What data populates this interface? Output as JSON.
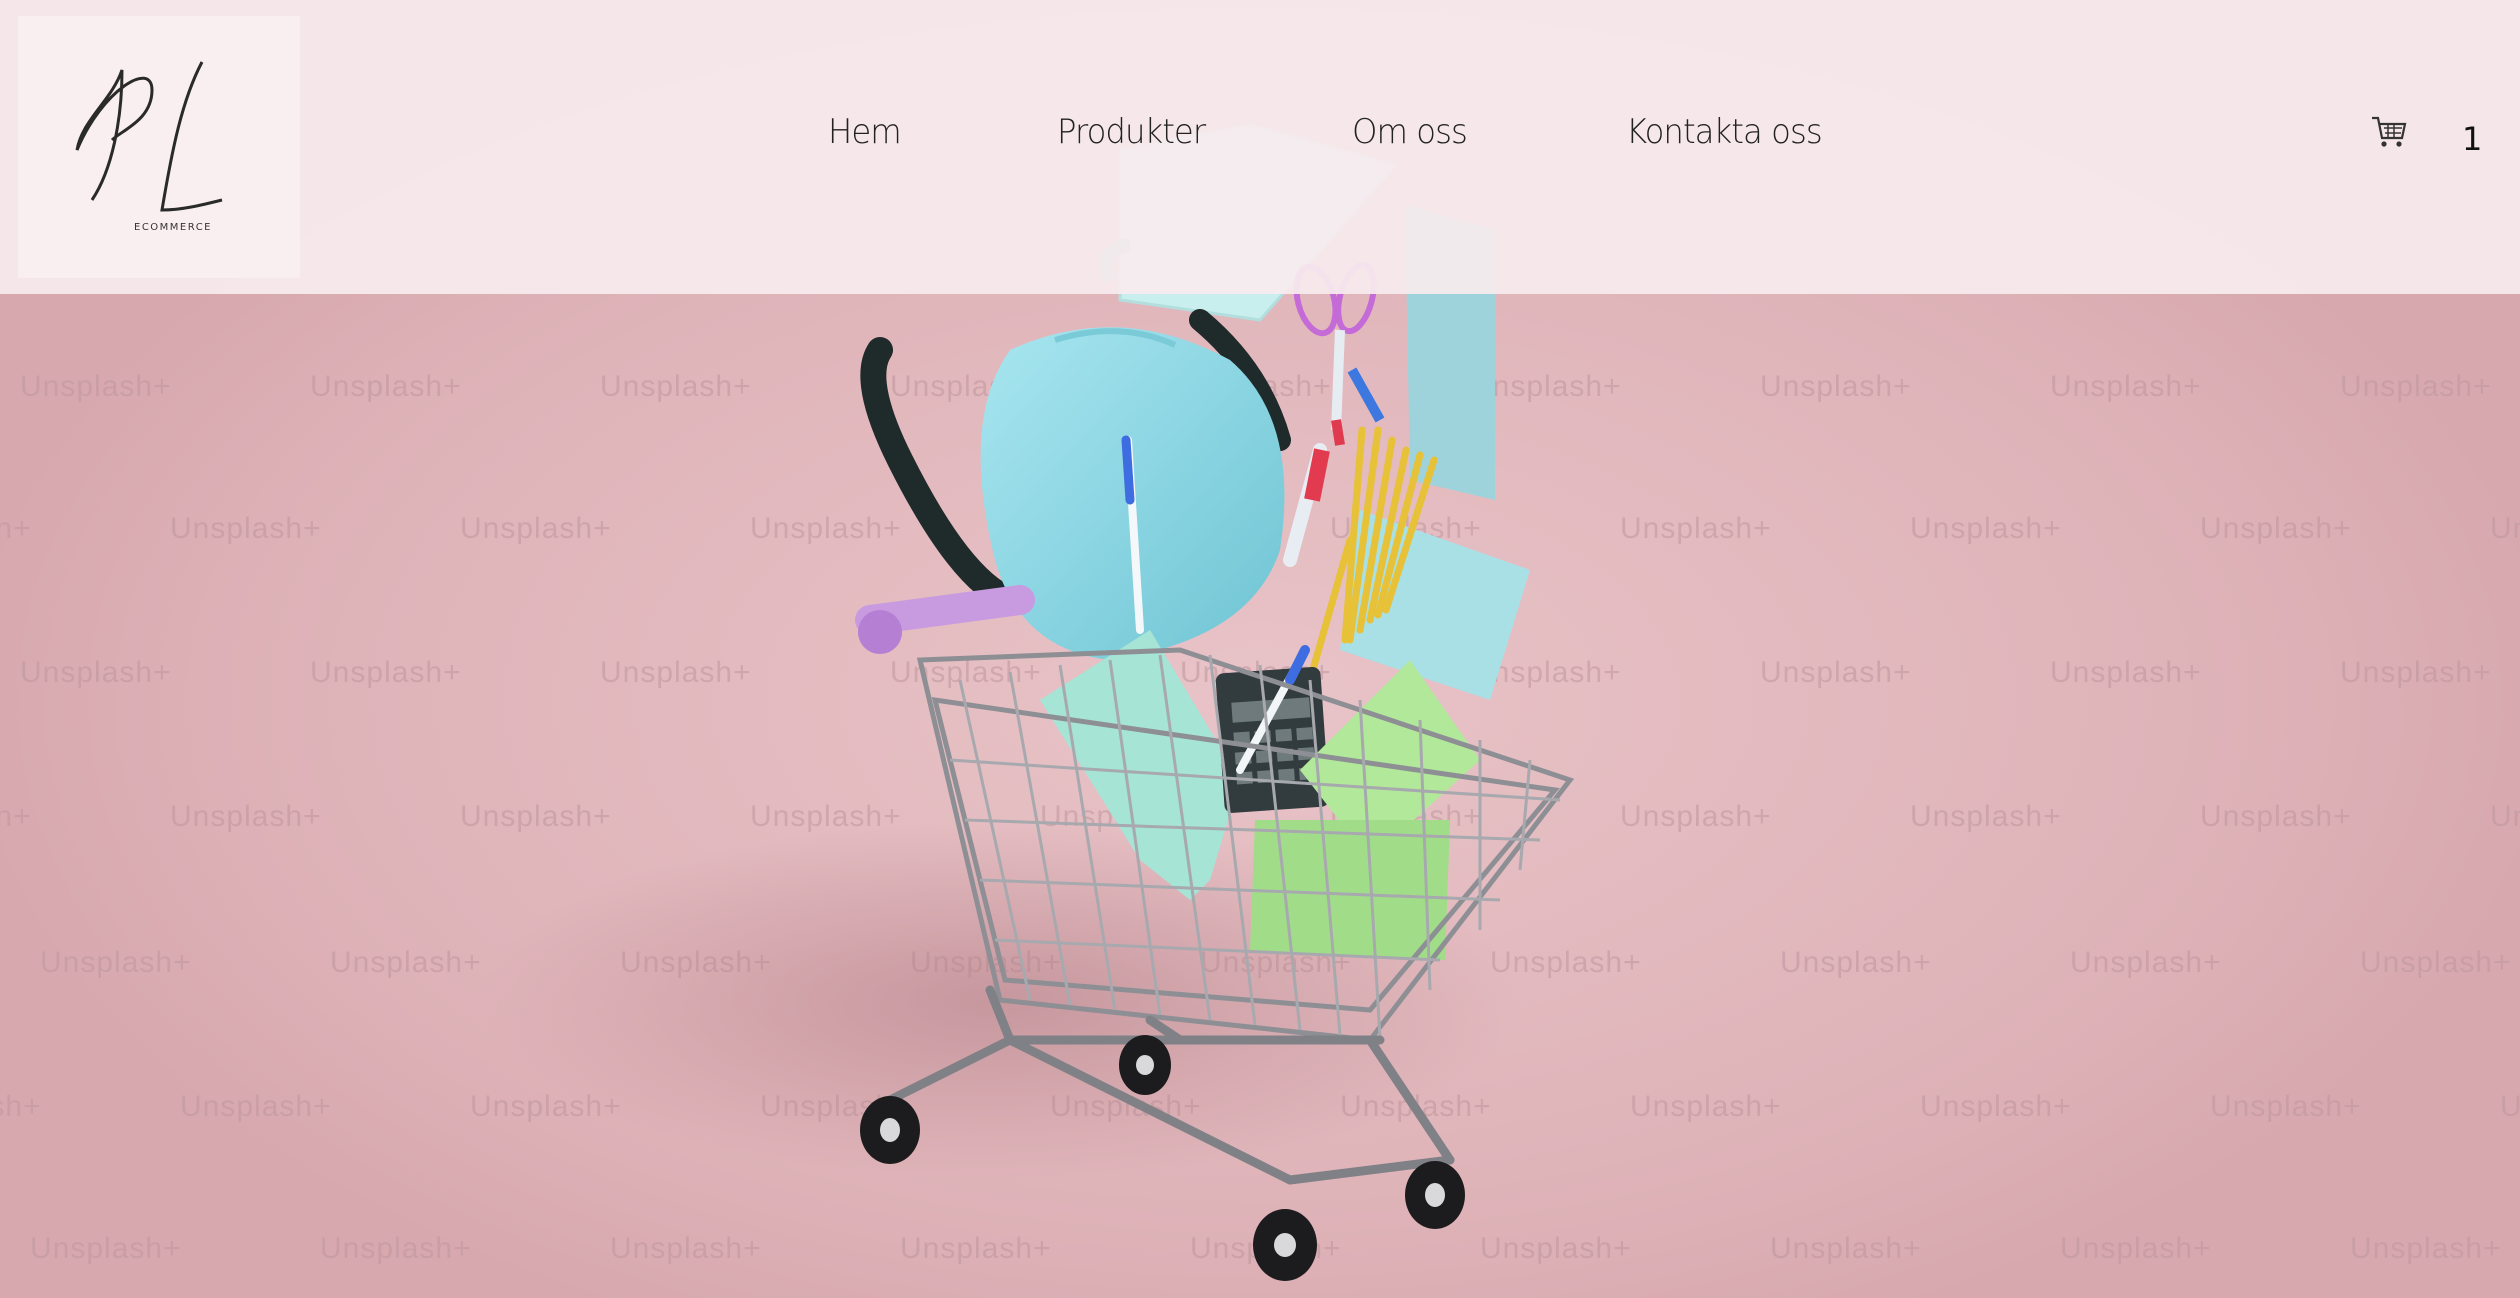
{
  "header": {
    "logo": {
      "monogram": "PL",
      "subtitle": "ECOMMERCE"
    },
    "nav": [
      {
        "label": "Hem"
      },
      {
        "label": "Produkter"
      },
      {
        "label": "Om oss"
      },
      {
        "label": "Kontakta oss"
      }
    ],
    "cart": {
      "icon": "shopping-cart-icon",
      "count": "1"
    }
  },
  "hero": {
    "watermark_text": "Unsplash+",
    "image_description_icon": "shopping-cart-school-supplies-illustration"
  },
  "colors": {
    "background": "#e3bcc1",
    "header_bg": "#f8ecee",
    "text": "#222222",
    "backpack": "#8fd6e3",
    "notebook_green": "#a9e08f",
    "notebook_teal": "#a6e4d6"
  }
}
